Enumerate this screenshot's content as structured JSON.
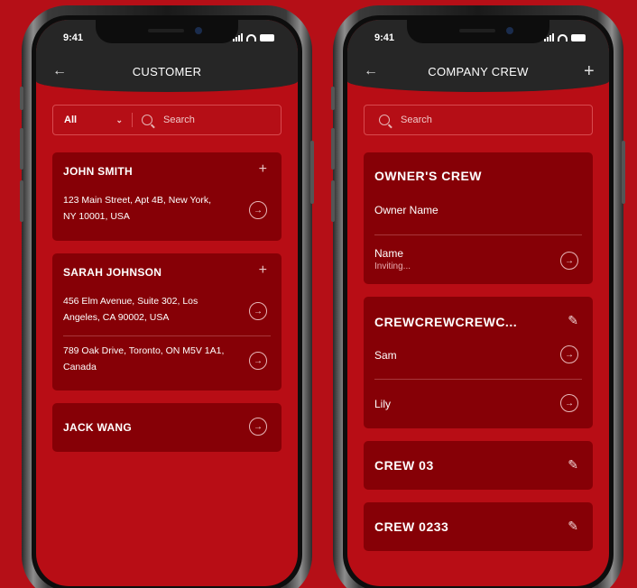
{
  "status": {
    "time": "9:41"
  },
  "left": {
    "title": "CUSTOMER",
    "filter": "All",
    "search_placeholder": "Search",
    "customers": [
      {
        "name": "JOHN SMITH",
        "addresses": [
          {
            "line1": "123 Main Street, Apt 4B, New York,",
            "line2": "NY 10001, USA"
          }
        ]
      },
      {
        "name": "SARAH JOHNSON",
        "addresses": [
          {
            "line1": "456 Elm Avenue, Suite 302, Los",
            "line2": "Angeles, CA 90002, USA"
          },
          {
            "line1": "789 Oak Drive, Toronto, ON M5V 1A1,",
            "line2": "Canada"
          }
        ]
      },
      {
        "name": "JACK WANG"
      }
    ]
  },
  "right": {
    "title": "COMPANY CREW",
    "search_placeholder": "Search",
    "owners_crew": {
      "title": "OWNER'S CREW",
      "owner_label": "Owner Name",
      "member_name": "Name",
      "member_status": "Inviting..."
    },
    "crews": [
      {
        "name": "CREWCREWCREWC...",
        "members": [
          "Sam",
          "Lily"
        ]
      },
      {
        "name": "CREW 03"
      },
      {
        "name": "CREW 0233"
      }
    ]
  },
  "colors": {
    "background": "#b50f17",
    "card": "#860006",
    "header": "#262626"
  },
  "icons": {
    "back": "arrow-left-icon",
    "add": "plus-icon",
    "open": "arrow-circle-right-icon",
    "edit": "pencil-icon",
    "search": "search-icon"
  }
}
